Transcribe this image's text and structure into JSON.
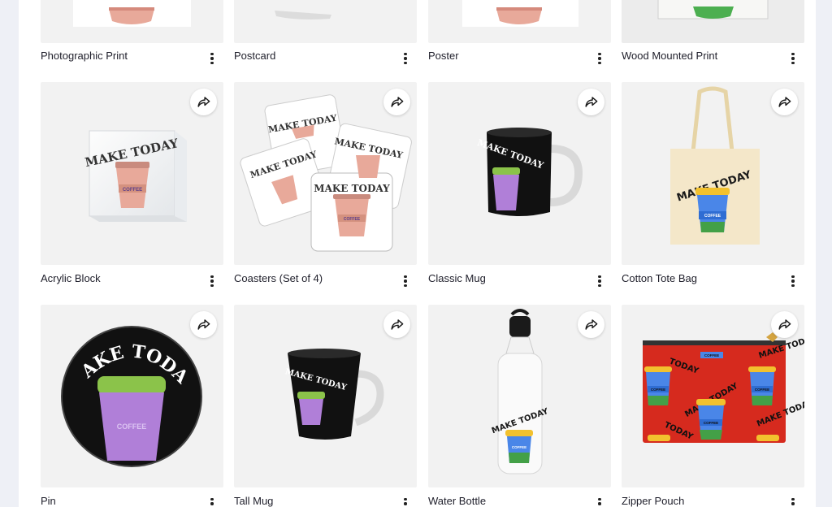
{
  "products": [
    {
      "title": "Photographic Print",
      "art": "photo-print"
    },
    {
      "title": "Postcard",
      "art": "postcard"
    },
    {
      "title": "Poster",
      "art": "poster"
    },
    {
      "title": "Wood Mounted Print",
      "art": "wood-print"
    },
    {
      "title": "Acrylic Block",
      "art": "acrylic"
    },
    {
      "title": "Coasters (Set of 4)",
      "art": "coasters"
    },
    {
      "title": "Classic Mug",
      "art": "classic-mug"
    },
    {
      "title": "Cotton Tote Bag",
      "art": "tote"
    },
    {
      "title": "Pin",
      "art": "pin"
    },
    {
      "title": "Tall Mug",
      "art": "tall-mug"
    },
    {
      "title": "Water Bottle",
      "art": "bottle"
    },
    {
      "title": "Zipper Pouch",
      "art": "pouch"
    }
  ],
  "design": {
    "text": "MAKE TODAY",
    "cup_text": "COFFEE"
  },
  "icons": {
    "share": "share-icon",
    "more": "more-vertical-icon"
  },
  "colors": {
    "pink_cup": "#e8a99a",
    "green_lid": "#8bc34a",
    "purple_cup": "#b07fd8",
    "pouch_red": "#d62a1e"
  }
}
